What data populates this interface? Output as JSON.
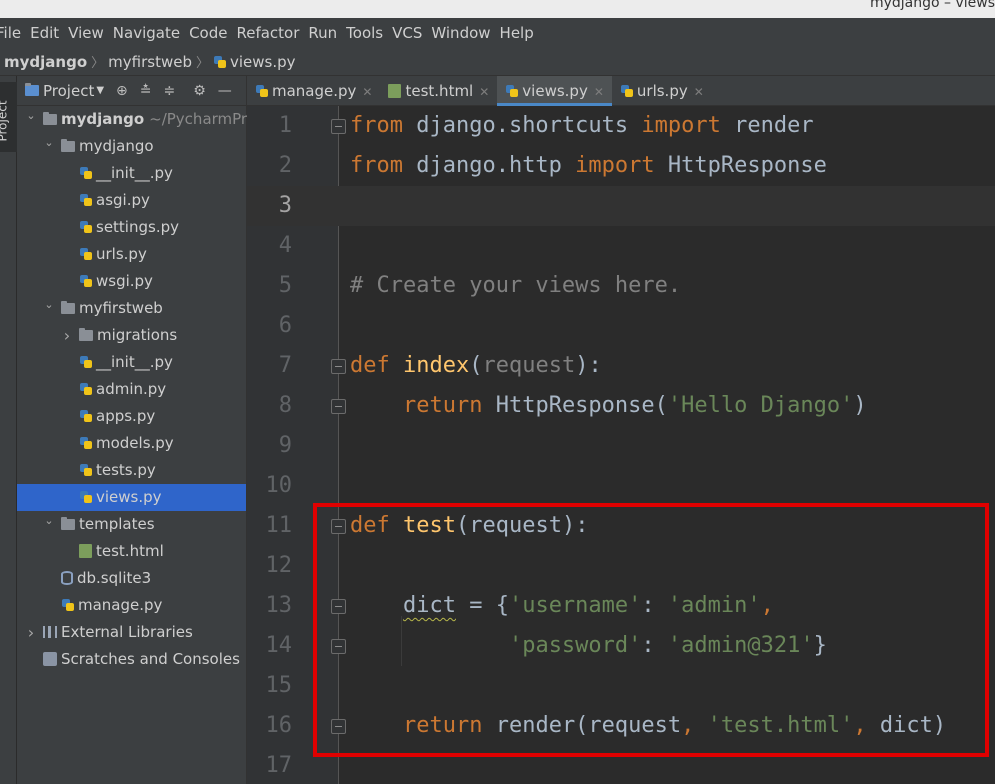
{
  "window": {
    "title": "mydjango – views"
  },
  "menu": [
    "File",
    "Edit",
    "View",
    "Navigate",
    "Code",
    "Refactor",
    "Run",
    "Tools",
    "VCS",
    "Window",
    "Help"
  ],
  "breadcrumb": [
    "mydjango",
    "myfirstweb",
    "views.py"
  ],
  "sidebar_tab": "Project",
  "project_panel": {
    "title": "Project",
    "tree": [
      {
        "label": "mydjango",
        "suffix": "~/PycharmProj",
        "kind": "folder",
        "depth": 0,
        "expanded": true,
        "bold": true
      },
      {
        "label": "mydjango",
        "kind": "folder",
        "depth": 1,
        "expanded": true
      },
      {
        "label": "__init__.py",
        "kind": "py",
        "depth": 2
      },
      {
        "label": "asgi.py",
        "kind": "py",
        "depth": 2
      },
      {
        "label": "settings.py",
        "kind": "py",
        "depth": 2
      },
      {
        "label": "urls.py",
        "kind": "py",
        "depth": 2
      },
      {
        "label": "wsgi.py",
        "kind": "py",
        "depth": 2
      },
      {
        "label": "myfirstweb",
        "kind": "folder",
        "depth": 1,
        "expanded": true
      },
      {
        "label": "migrations",
        "kind": "folder",
        "depth": 2,
        "expanded": false
      },
      {
        "label": "__init__.py",
        "kind": "py",
        "depth": 2
      },
      {
        "label": "admin.py",
        "kind": "py",
        "depth": 2
      },
      {
        "label": "apps.py",
        "kind": "py",
        "depth": 2
      },
      {
        "label": "models.py",
        "kind": "py",
        "depth": 2
      },
      {
        "label": "tests.py",
        "kind": "py",
        "depth": 2
      },
      {
        "label": "views.py",
        "kind": "py",
        "depth": 2,
        "selected": true
      },
      {
        "label": "templates",
        "kind": "folder",
        "depth": 1,
        "expanded": true
      },
      {
        "label": "test.html",
        "kind": "html",
        "depth": 2
      },
      {
        "label": "db.sqlite3",
        "kind": "db",
        "depth": 1
      },
      {
        "label": "manage.py",
        "kind": "py",
        "depth": 1
      },
      {
        "label": "External Libraries",
        "kind": "lib",
        "depth": 0,
        "expanded": false
      },
      {
        "label": "Scratches and Consoles",
        "kind": "scratch",
        "depth": 0
      }
    ]
  },
  "tabs": [
    {
      "label": "manage.py",
      "icon": "python-file-icon",
      "active": false
    },
    {
      "label": "test.html",
      "icon": "html-file-icon",
      "active": false
    },
    {
      "label": "views.py",
      "icon": "python-file-icon",
      "active": true
    },
    {
      "label": "urls.py",
      "icon": "python-file-icon",
      "active": false
    }
  ],
  "editor": {
    "current_line": 3,
    "lines": [
      [
        [
          "kw",
          "from"
        ],
        [
          "t",
          " django.shortcuts "
        ],
        [
          "kw",
          "import"
        ],
        [
          "t",
          " render"
        ]
      ],
      [
        [
          "kw",
          "from"
        ],
        [
          "t",
          " django.http "
        ],
        [
          "kw",
          "import"
        ],
        [
          "t",
          " HttpResponse"
        ]
      ],
      [],
      [],
      [
        [
          "cmt",
          "# Create your views here."
        ]
      ],
      [],
      [
        [
          "kw",
          "def"
        ],
        [
          "t",
          " "
        ],
        [
          "fn",
          "index"
        ],
        [
          "t",
          "("
        ],
        [
          "param",
          "request"
        ],
        [
          "t",
          "):"
        ]
      ],
      [
        [
          "t",
          "    "
        ],
        [
          "kw",
          "return"
        ],
        [
          "t",
          " HttpResponse("
        ],
        [
          "str",
          "'Hello Django'"
        ],
        [
          "t",
          ")"
        ]
      ],
      [],
      [],
      [
        [
          "kw",
          "def"
        ],
        [
          "t",
          " "
        ],
        [
          "fn",
          "test"
        ],
        [
          "t",
          "(request):"
        ]
      ],
      [],
      [
        [
          "t",
          "    "
        ],
        [
          "warn",
          "dict"
        ],
        [
          "t",
          " = {"
        ],
        [
          "str",
          "'username'"
        ],
        [
          "t",
          ": "
        ],
        [
          "str",
          "'admin'"
        ],
        [
          "kw",
          ","
        ]
      ],
      [
        [
          "t",
          "            "
        ],
        [
          "str",
          "'password'"
        ],
        [
          "t",
          ": "
        ],
        [
          "str",
          "'admin@321'"
        ],
        [
          "t",
          "}"
        ]
      ],
      [],
      [
        [
          "t",
          "    "
        ],
        [
          "kw",
          "return"
        ],
        [
          "t",
          " render(request"
        ],
        [
          "kw",
          ","
        ],
        [
          "t",
          " "
        ],
        [
          "str",
          "'test.html'"
        ],
        [
          "kw",
          ","
        ],
        [
          "t",
          " dict)"
        ]
      ],
      []
    ],
    "fold_markers": [
      1,
      7,
      8,
      11,
      13,
      14,
      16
    ]
  },
  "colors": {
    "keyword": "#cc7832",
    "function": "#ffc66d",
    "string": "#6a8759",
    "comment": "#808080",
    "default": "#a9b7c6",
    "selection": "#2f65ca",
    "annotation_box": "#e00000"
  }
}
